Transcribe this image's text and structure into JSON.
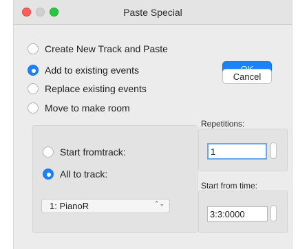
{
  "window": {
    "title": "Paste Special"
  },
  "mode_options": [
    {
      "label": "Create New Track and Paste",
      "selected": false
    },
    {
      "label": "Add to existing events",
      "selected": true
    },
    {
      "label": "Replace existing events",
      "selected": false
    },
    {
      "label": "Move to make room",
      "selected": false
    }
  ],
  "buttons": {
    "ok_label": "OK",
    "cancel_label": "Cancel"
  },
  "track_options": [
    {
      "label": "Start fromtrack:",
      "selected": false
    },
    {
      "label": "All to track:",
      "selected": true
    }
  ],
  "track_select": {
    "value": "1: PianoR",
    "arrows": "⌃⌄"
  },
  "repetitions": {
    "label": "Repetitions:",
    "value": "1"
  },
  "start_time": {
    "label": "Start from time:",
    "value": "3:3:0000"
  },
  "colors": {
    "accent": "#1a82fb",
    "window_bg": "#ececec"
  }
}
